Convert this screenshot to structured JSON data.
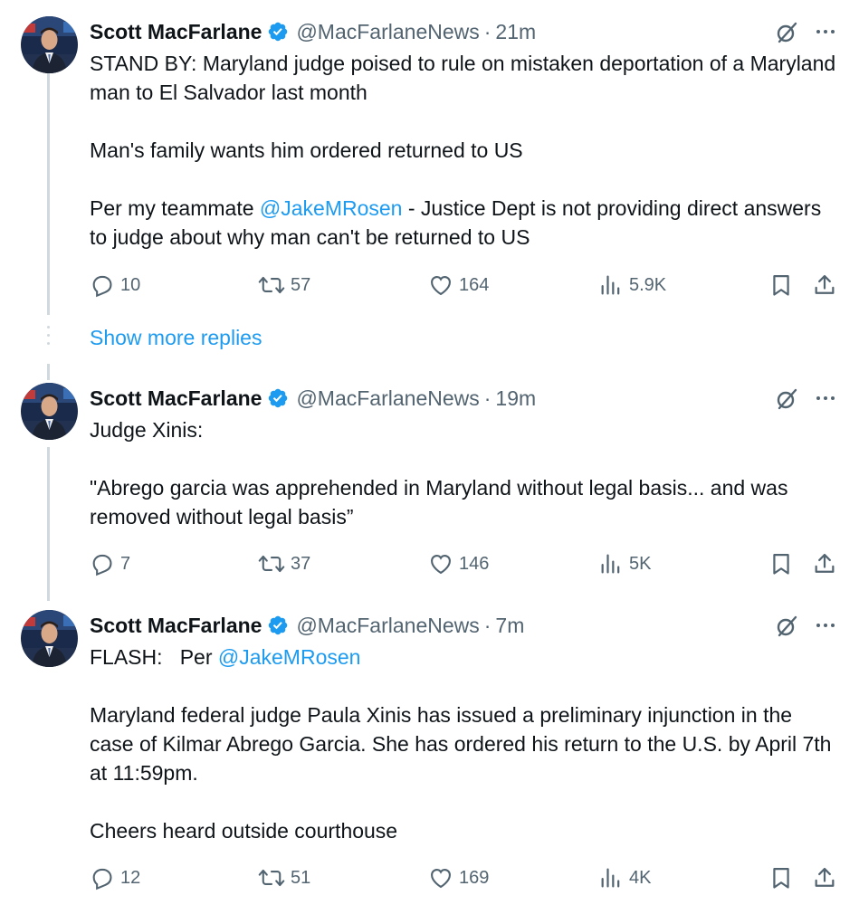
{
  "show_more_replies": "Show more replies",
  "colors": {
    "link": "#1d9bf0",
    "secondary_text": "#536471",
    "primary_text": "#0f1419",
    "thread_line": "#cfd9de",
    "verified_badge": "#1d9bf0"
  },
  "icons": {
    "reply": "speech-bubble-icon",
    "retweet": "retweet-icon",
    "like": "heart-icon",
    "views": "bar-chart-icon",
    "bookmark": "bookmark-icon",
    "share": "share-upload-icon",
    "grok": "grok-slash-circle-icon",
    "more": "more-dots-icon",
    "verified": "verified-badge-icon"
  },
  "tweets": [
    {
      "author_name": "Scott MacFarlane",
      "handle": "@MacFarlaneNews",
      "separator": "·",
      "time": "21m",
      "paragraphs": [
        {
          "text": "STAND BY:  Maryland judge poised to rule on mistaken deportation of a Maryland man to El Salvador last month"
        },
        {
          "text": "Man's family wants him ordered returned to US"
        },
        {
          "before": "Per my teammate ",
          "mention": "@JakeMRosen",
          "after": " - Justice Dept is not providing direct answers to judge about why man can't be returned to US"
        }
      ],
      "replies": "10",
      "reposts": "57",
      "likes": "164",
      "views": "5.9K"
    },
    {
      "author_name": "Scott MacFarlane",
      "handle": "@MacFarlaneNews",
      "separator": "·",
      "time": "19m",
      "paragraphs": [
        {
          "text": "Judge Xinis:"
        },
        {
          "text": "\"Abrego garcia was apprehended in Maryland without legal basis... and was removed without legal basis”"
        }
      ],
      "replies": "7",
      "reposts": "37",
      "likes": "146",
      "views": "5K"
    },
    {
      "author_name": "Scott MacFarlane",
      "handle": "@MacFarlaneNews",
      "separator": "·",
      "time": "7m",
      "paragraphs": [
        {
          "before": "FLASH:   Per ",
          "mention": "@JakeMRosen",
          "after": ""
        },
        {
          "text": "Maryland federal judge Paula Xinis has issued a preliminary injunction in the case of Kilmar Abrego Garcia. She has ordered his return to the U.S. by April 7th at 11:59pm."
        },
        {
          "text": "Cheers heard outside courthouse"
        }
      ],
      "replies": "12",
      "reposts": "51",
      "likes": "169",
      "views": "4K"
    }
  ]
}
